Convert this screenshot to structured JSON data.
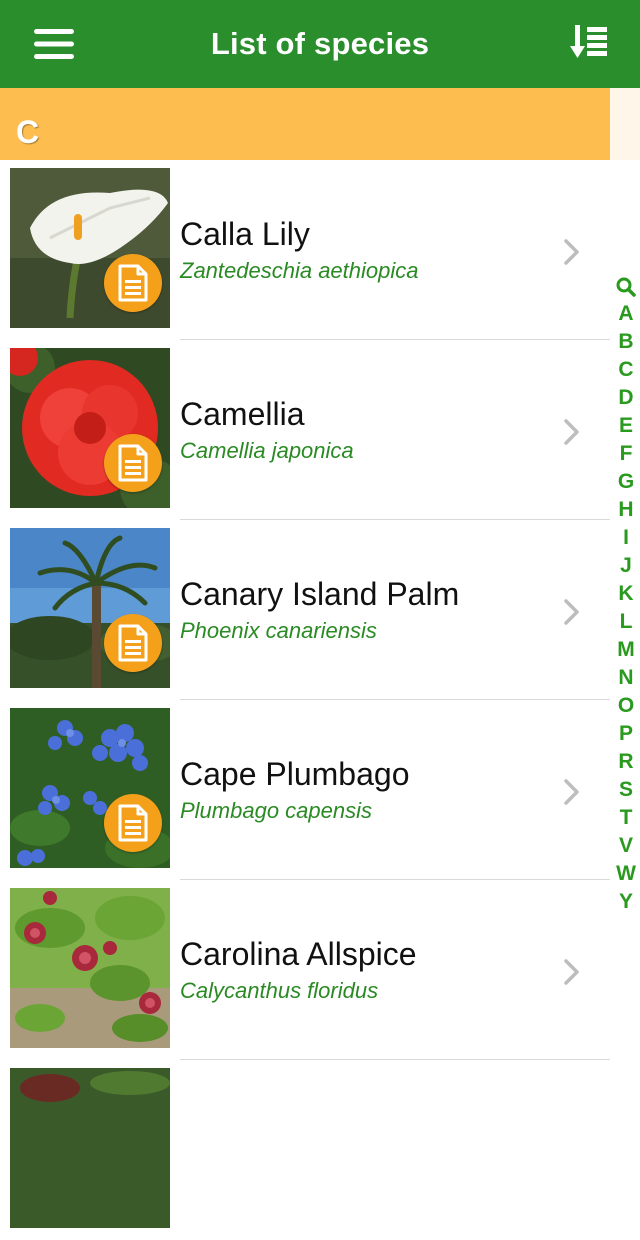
{
  "header": {
    "title": "List of species",
    "menu_icon": "hamburger-menu-icon",
    "sort_icon": "sort-list-icon"
  },
  "section": {
    "letter": "C"
  },
  "species": [
    {
      "name": "Calla Lily",
      "scientific": "Zantedeschia aethiopica",
      "has_doc": true
    },
    {
      "name": "Camellia",
      "scientific": "Camellia japonica",
      "has_doc": true
    },
    {
      "name": "Canary Island Palm",
      "scientific": "Phoenix canariensis",
      "has_doc": true
    },
    {
      "name": "Cape Plumbago",
      "scientific": "Plumbago capensis",
      "has_doc": true
    },
    {
      "name": "Carolina Allspice",
      "scientific": "Calycanthus floridus",
      "has_doc": false
    }
  ],
  "index": {
    "search_icon": "search-icon",
    "letters": [
      "A",
      "B",
      "C",
      "D",
      "E",
      "F",
      "G",
      "H",
      "I",
      "J",
      "K",
      "L",
      "M",
      "N",
      "O",
      "P",
      "R",
      "S",
      "T",
      "V",
      "W",
      "Y"
    ]
  },
  "colors": {
    "header": "#2a8e2c",
    "section": "#fdbe4f",
    "scientific_text": "#2a8a23",
    "badge": "#f5a01b",
    "index_text": "#2a9a1f"
  }
}
